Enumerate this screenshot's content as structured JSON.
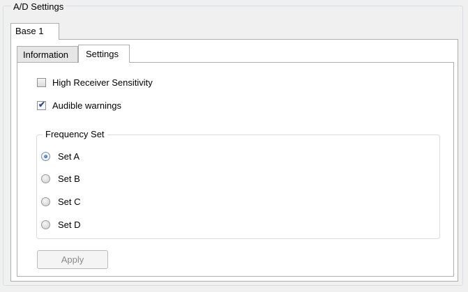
{
  "group_title": "A/D Settings",
  "outer_tab": {
    "label": "Base 1"
  },
  "inner_tabs": [
    {
      "label": "Information",
      "active": false
    },
    {
      "label": "Settings",
      "active": true
    }
  ],
  "options": {
    "high_receiver_sensitivity": {
      "label": "High Receiver Sensitivity",
      "checked": false
    },
    "audible_warnings": {
      "label": "Audible warnings",
      "checked": true
    }
  },
  "frequency_set": {
    "title": "Frequency Set",
    "selected": "Set A",
    "items": [
      "Set A",
      "Set B",
      "Set C",
      "Set D"
    ]
  },
  "apply_button": {
    "label": "Apply",
    "enabled": false
  },
  "colors": {
    "selected_radio": "#1b4f9c",
    "check_mark": "#2b4c8a",
    "border": "#adadad"
  }
}
